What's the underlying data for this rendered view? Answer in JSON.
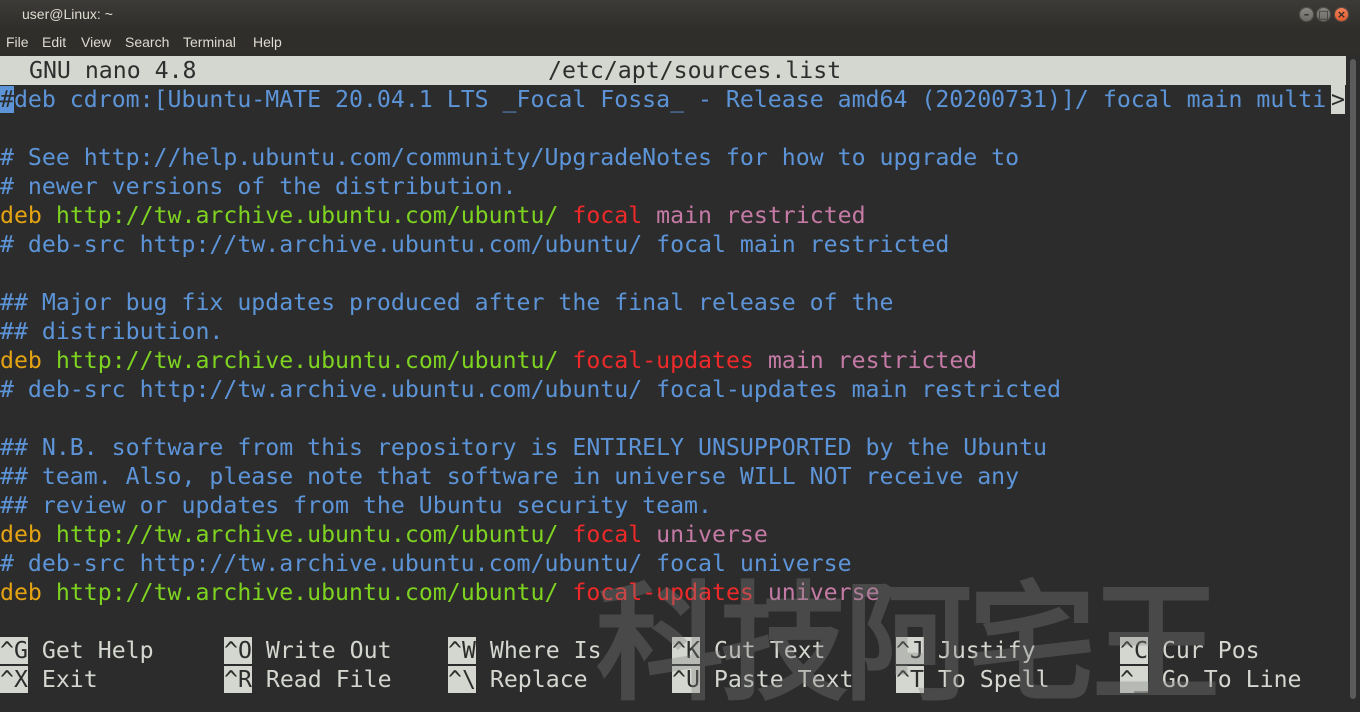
{
  "window": {
    "title": "user@Linux: ~"
  },
  "menu": [
    "File",
    "Edit",
    "View",
    "Search",
    "Terminal",
    "Help"
  ],
  "nano": {
    "version_label": "GNU nano 4.8",
    "filename": "/etc/apt/sources.list",
    "first_line": {
      "cursor_char": "#",
      "rest": "deb cdrom:[Ubuntu-MATE 20.04.1 LTS _Focal Fossa_ - Release amd64 (20200731)]/ focal main multi",
      "more_marker": ">"
    }
  },
  "lines": {
    "l3": "# See http://help.ubuntu.com/community/UpgradeNotes for how to upgrade to",
    "l4": "# newer versions of the distribution.",
    "l5": {
      "deb": "deb",
      "url": "http://tw.archive.ubuntu.com/ubuntu/",
      "release": "focal",
      "components": "main restricted"
    },
    "l6": "# deb-src http://tw.archive.ubuntu.com/ubuntu/ focal main restricted",
    "l8": "## Major bug fix updates produced after the final release of the",
    "l9": "## distribution.",
    "l10": {
      "deb": "deb",
      "url": "http://tw.archive.ubuntu.com/ubuntu/",
      "release": "focal-updates",
      "components": "main restricted"
    },
    "l11": "# deb-src http://tw.archive.ubuntu.com/ubuntu/ focal-updates main restricted",
    "l13": "## N.B. software from this repository is ENTIRELY UNSUPPORTED by the Ubuntu",
    "l14": "## team. Also, please note that software in universe WILL NOT receive any",
    "l15": "## review or updates from the Ubuntu security team.",
    "l16": {
      "deb": "deb",
      "url": "http://tw.archive.ubuntu.com/ubuntu/",
      "release": "focal",
      "components": "universe"
    },
    "l17": "# deb-src http://tw.archive.ubuntu.com/ubuntu/ focal universe",
    "l18": {
      "deb": "deb",
      "url": "http://tw.archive.ubuntu.com/ubuntu/",
      "release": "focal-updates",
      "components": "universe"
    }
  },
  "shortcuts": {
    "row1": [
      {
        "key": "^G",
        "label": "Get Help"
      },
      {
        "key": "^O",
        "label": "Write Out"
      },
      {
        "key": "^W",
        "label": "Where Is"
      },
      {
        "key": "^K",
        "label": "Cut Text"
      },
      {
        "key": "^J",
        "label": "Justify"
      },
      {
        "key": "^C",
        "label": "Cur Pos"
      }
    ],
    "row2": [
      {
        "key": "^X",
        "label": "Exit"
      },
      {
        "key": "^R",
        "label": "Read File"
      },
      {
        "key": "^\\",
        "label": "Replace"
      },
      {
        "key": "^U",
        "label": "Paste Text"
      },
      {
        "key": "^T",
        "label": "To Spell"
      },
      {
        "key": "^_",
        "label": "Go To Line"
      }
    ]
  },
  "watermark": "科技阿宅王"
}
